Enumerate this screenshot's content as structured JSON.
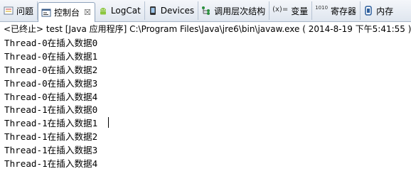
{
  "tabs": [
    {
      "label": "问题",
      "icon": "problems-icon"
    },
    {
      "label": "控制台",
      "icon": "console-icon",
      "active": true
    },
    {
      "label": "LogCat",
      "icon": "android-icon"
    },
    {
      "label": "Devices",
      "icon": "device-icon"
    },
    {
      "label": "调用层次结构",
      "icon": "call-hierarchy-icon"
    },
    {
      "label": "变量",
      "icon": "variables-icon",
      "icon_text": "(x)="
    },
    {
      "label": "寄存器",
      "icon": "registers-icon",
      "icon_text": "1010"
    },
    {
      "label": "内存",
      "icon": "memory-icon"
    }
  ],
  "tab_close_glyph": "☒",
  "status": "<已终止> test [Java 应用程序] C:\\Program Files\\Java\\jre6\\bin\\javaw.exe ( 2014-8-19 下午5:41:55 )",
  "output_lines": [
    "Thread-0在插入数据0",
    "Thread-0在插入数据1",
    "Thread-0在插入数据2",
    "Thread-0在插入数据3",
    "Thread-0在插入数据4",
    "Thread-1在插入数据0",
    "Thread-1在插入数据1",
    "Thread-1在插入数据2",
    "Thread-1在插入数据3",
    "Thread-1在插入数据4"
  ]
}
